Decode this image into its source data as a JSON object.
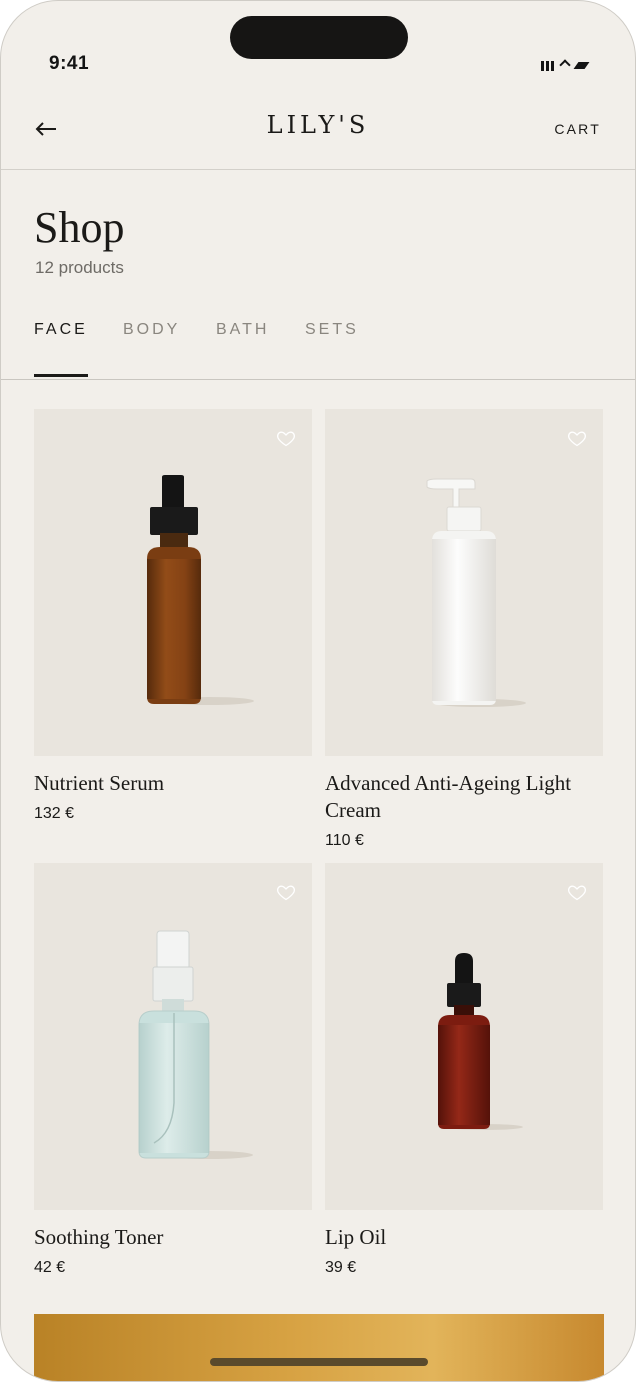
{
  "status_bar": {
    "time": "9:41"
  },
  "header": {
    "brand": "LILY'S",
    "cart_label": "CART"
  },
  "page": {
    "title": "Shop",
    "product_count": "12 products"
  },
  "tabs": [
    {
      "label": "FACE",
      "active": true
    },
    {
      "label": "BODY",
      "active": false
    },
    {
      "label": "BATH",
      "active": false
    },
    {
      "label": "SETS",
      "active": false
    }
  ],
  "products": [
    {
      "name": "Nutrient Serum",
      "price": "132 €",
      "image": "amber-dropper-bottle"
    },
    {
      "name": "Advanced Anti-Ageing Light Cream",
      "price": "110 €",
      "image": "white-pump-bottle"
    },
    {
      "name": "Soothing Toner",
      "price": "42 €",
      "image": "clear-spray-bottle"
    },
    {
      "name": "Lip Oil",
      "price": "39 €",
      "image": "red-dropper-bottle"
    }
  ],
  "colors": {
    "background": "#f2efea",
    "text": "#1b1a18",
    "muted": "#8a867f",
    "banner": "#d7a243"
  }
}
